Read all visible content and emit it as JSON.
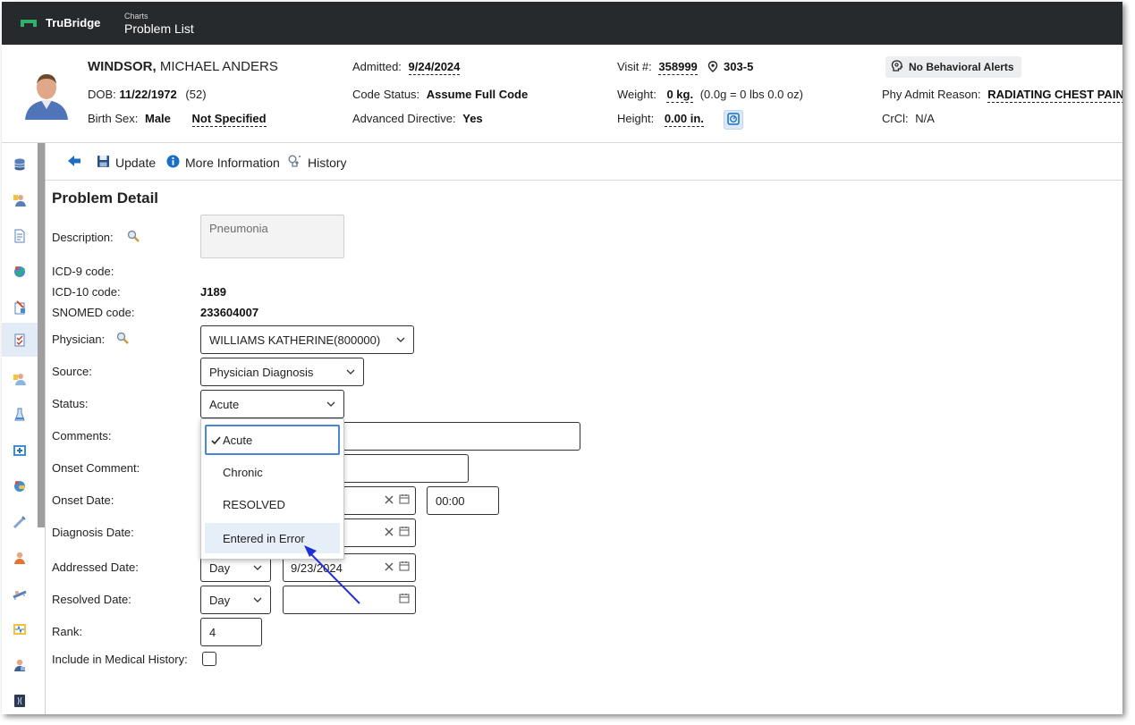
{
  "app": {
    "brand": "TruBridge",
    "breadcrumb_small": "Charts",
    "breadcrumb_title": "Problem List"
  },
  "patient": {
    "last_name": "WINDSOR,",
    "first_name": "MICHAEL ANDERS",
    "dob_label": "DOB:",
    "dob": "11/22/1972",
    "age": "(52)",
    "birth_sex_label": "Birth Sex:",
    "birth_sex": "Male",
    "gender_identity": "Not Specified",
    "admitted_label": "Admitted:",
    "admitted": "9/24/2024",
    "code_status_label": "Code Status:",
    "code_status": "Assume Full Code",
    "adv_directive_label": "Advanced Directive:",
    "adv_directive": "Yes",
    "visit_label": "Visit #:",
    "visit": "358999",
    "room": "303-5",
    "weight_label": "Weight:",
    "weight": "0 kg.",
    "weight_note": "(0.0g = 0 lbs 0.0 oz)",
    "height_label": "Height:",
    "height": "0.00 in.",
    "behavioral_alerts": "No Behavioral Alerts",
    "admit_reason_label": "Phy Admit Reason:",
    "admit_reason": "RADIATING CHEST PAIN",
    "crcl_label": "CrCl:",
    "crcl": "N/A"
  },
  "toolbar": {
    "update": "Update",
    "more_info": "More Information",
    "history": "History"
  },
  "form": {
    "title": "Problem Detail",
    "description_label": "Description:",
    "description_value": "Pneumonia",
    "icd9_label": "ICD-9 code:",
    "icd10_label": "ICD-10 code:",
    "icd10_value": "J189",
    "snomed_label": "SNOMED code:",
    "snomed_value": "233604007",
    "physician_label": "Physician:",
    "physician_value": "WILLIAMS KATHERINE(800000)",
    "source_label": "Source:",
    "source_value": "Physician Diagnosis",
    "status_label": "Status:",
    "status_value": "Acute",
    "comments_label": "Comments:",
    "onset_comment_label": "Onset Comment:",
    "onset_date_label": "Onset Date:",
    "onset_time": "00:00",
    "diagnosis_date_label": "Diagnosis Date:",
    "addressed_date_label": "Addressed Date:",
    "addressed_precision": "Day",
    "addressed_date": "9/23/2024",
    "resolved_date_label": "Resolved Date:",
    "resolved_precision": "Day",
    "rank_label": "Rank:",
    "rank_value": "4",
    "include_history_label": "Include in Medical History:"
  },
  "status_options": [
    "Acute",
    "Chronic",
    "RESOLVED",
    "Entered in Error"
  ],
  "colors": {
    "topbar": "#262a2d",
    "accent_blue": "#1a6fc4",
    "arrow": "#1f2fd6",
    "logo_green": "#2fb36b"
  }
}
